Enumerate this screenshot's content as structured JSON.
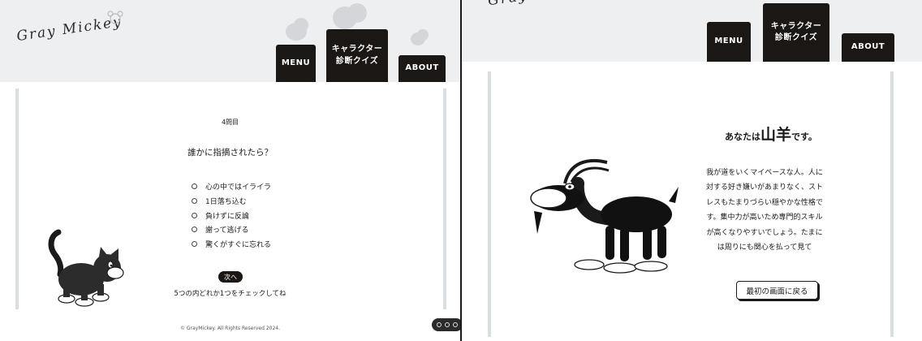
{
  "left_screen": {
    "logo": "Gray Mickey",
    "nav": {
      "menu": "MENU",
      "quiz_line1": "キャラクター",
      "quiz_line2": "診断クイズ",
      "about": "ABOUT"
    },
    "quiz": {
      "number": "4問目",
      "question": "誰かに指摘されたら？",
      "options": [
        "心の中ではイライラ",
        "1日落ち込む",
        "負けずに反論",
        "謝って逃げる",
        "驚くがすぐに忘れる"
      ],
      "next_label": "次へ",
      "hint": "5つの内どれか1つをチェックしてね"
    },
    "footer": "© GrayMickey. All Rights Reserved 2024.",
    "illustration_icon": "cat-illustration"
  },
  "right_screen": {
    "logo_partial": "Gray",
    "nav": {
      "menu": "MENU",
      "quiz_line1": "キャラクター",
      "quiz_line2": "診断クイズ",
      "about": "ABOUT"
    },
    "result": {
      "prefix": "あなたは",
      "animal": "山羊",
      "suffix": "です。",
      "description": "我が道をいくマイペースな人。人に対する好き嫌いがあまりなく、ストレスもたまりづらい穏やかな性格です。集中力が高いため専門的スキルが高くなりやすいでしょう。たまには周りにも関心を払って見て",
      "back_label": "最初の画面に戻る"
    },
    "illustration_icon": "goat-illustration"
  },
  "colors": {
    "header_bg": "#eeeff1",
    "nav_bg": "#1b1715",
    "card_edge": "#d9dee2"
  }
}
